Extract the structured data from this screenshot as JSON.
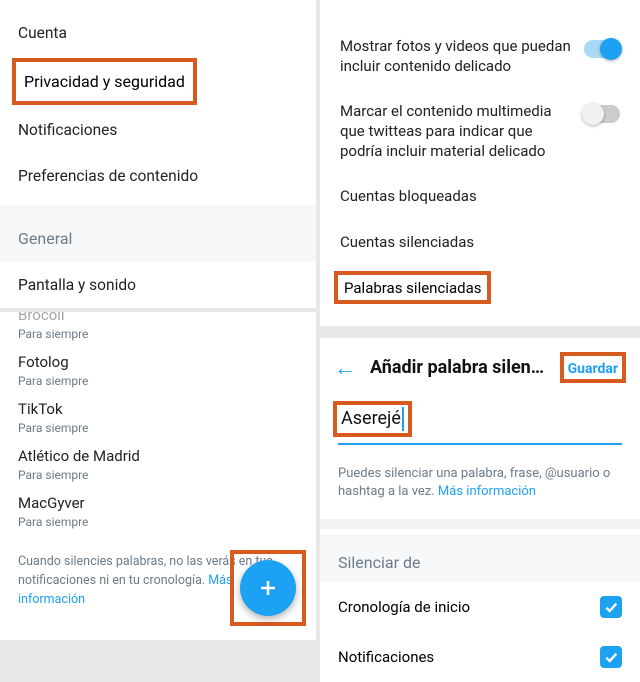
{
  "left": {
    "menu": {
      "account": "Cuenta",
      "privacy": "Privacidad y seguridad",
      "notifications": "Notificaciones",
      "contentPrefs": "Preferencias de contenido"
    },
    "generalHeader": "General",
    "screenSound": "Pantalla y sonido",
    "mutedWords": [
      {
        "title": "Brocoli",
        "sub": "Para siempre"
      },
      {
        "title": "Fotolog",
        "sub": "Para siempre"
      },
      {
        "title": "TikTok",
        "sub": "Para siempre"
      },
      {
        "title": "Atlético de Madrid",
        "sub": "Para siempre"
      },
      {
        "title": "MacGyver",
        "sub": "Para siempre"
      }
    ],
    "footer": {
      "text": "Cuando silencies palabras, no las verás en tus notificaciones ni en tu cronología. ",
      "link": "Más información"
    }
  },
  "rightTop": {
    "sensitiveMedia": "Mostrar fotos y videos que puedan incluir contenido delicado",
    "markSensitive": "Marcar el contenido multimedia que twitteas para indicar que podría incluir material delicado",
    "blocked": "Cuentas bloqueadas",
    "mutedAccts": "Cuentas silenciadas",
    "mutedWords": "Palabras silenciadas"
  },
  "rightBottom": {
    "title": "Añadir palabra silen…",
    "save": "Guardar",
    "inputValue": "Aserejé",
    "helper": {
      "text": "Puedes silenciar una palabra, frase, @usuario o hashtag a la vez. ",
      "link": "Más información"
    },
    "sectionHeader": "Silenciar de",
    "homeTimeline": "Cronología de inicio",
    "notifications": "Notificaciones"
  }
}
